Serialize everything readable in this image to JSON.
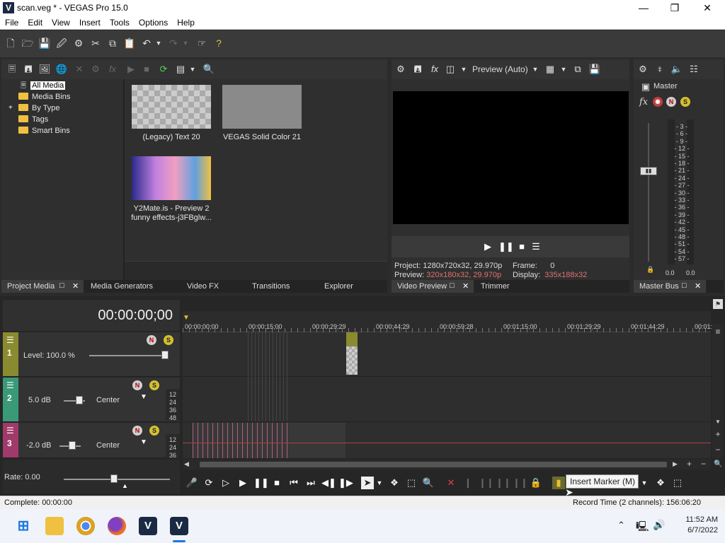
{
  "window": {
    "title": "scan.veg * - VEGAS Pro 15.0",
    "app_icon": "V"
  },
  "menu": [
    "File",
    "Edit",
    "View",
    "Insert",
    "Tools",
    "Options",
    "Help"
  ],
  "media": {
    "tree": [
      {
        "label": "All Media",
        "selected": true,
        "icon": "media-icon"
      },
      {
        "label": "Media Bins",
        "icon": "folder-icon"
      },
      {
        "label": "By Type",
        "icon": "folder-icon",
        "expander": "+"
      },
      {
        "label": "Tags",
        "icon": "folder-icon"
      },
      {
        "label": "Smart Bins",
        "icon": "folder-icon"
      }
    ],
    "items": [
      {
        "label": "(Legacy) Text 20"
      },
      {
        "label": "VEGAS Solid Color 21"
      },
      {
        "label": "Y2Mate.is - Preview 2",
        "label2": "funny effects-j3FBglw..."
      }
    ]
  },
  "left_tabs": [
    "Project Media",
    "Media Generators",
    "Video FX",
    "Transitions",
    "Explorer"
  ],
  "preview": {
    "quality": "Preview (Auto)",
    "project_label": "Project:",
    "project_value": "1280x720x32, 29.970p",
    "preview_label": "Preview:",
    "preview_value": "320x180x32, 29.970p",
    "frame_label": "Frame:",
    "frame_value": "0",
    "display_label": "Display:",
    "display_value": "335x188x32",
    "tabs": [
      "Video Preview",
      "Trimmer"
    ]
  },
  "master": {
    "label": "Master",
    "fx": "fx",
    "scale": [
      "3",
      "6",
      "9",
      "12",
      "15",
      "18",
      "21",
      "24",
      "27",
      "30",
      "33",
      "36",
      "39",
      "42",
      "45",
      "48",
      "51",
      "54",
      "57"
    ],
    "left_value": "0.0",
    "right_value": "0.0",
    "tab": "Master Bus"
  },
  "timeline": {
    "timecode": "00:00:00;00",
    "ruler": [
      "00:00:00;00",
      "00:00:15;00",
      "00:00:29;29",
      "00:00:44;29",
      "00:00:59;28",
      "00:01:15;00",
      "00:01:29;29",
      "00:01:44;29",
      "00:01:"
    ],
    "tracks": [
      {
        "number": "1",
        "level": "Level: 100.0 %",
        "color": "#8a8a30",
        "level_value": 1.0
      },
      {
        "number": "2",
        "volume": "5.0 dB",
        "pan": "Center",
        "color": "#3a9a78",
        "meter": [
          "12",
          "24",
          "36",
          "48"
        ]
      },
      {
        "number": "3",
        "volume": "-2.0 dB",
        "pan": "Center",
        "color": "#a03a6a",
        "meter": [
          "12",
          "24",
          "36"
        ]
      }
    ],
    "rate": "Rate: 0.00"
  },
  "tooltip": "Insert Marker (M)",
  "status": {
    "left": "Complete: 00:00:00",
    "right": "Record Time (2 channels): 156:06:20"
  },
  "taskbar": {
    "time": "11:52 AM",
    "date": "6/7/2022"
  }
}
